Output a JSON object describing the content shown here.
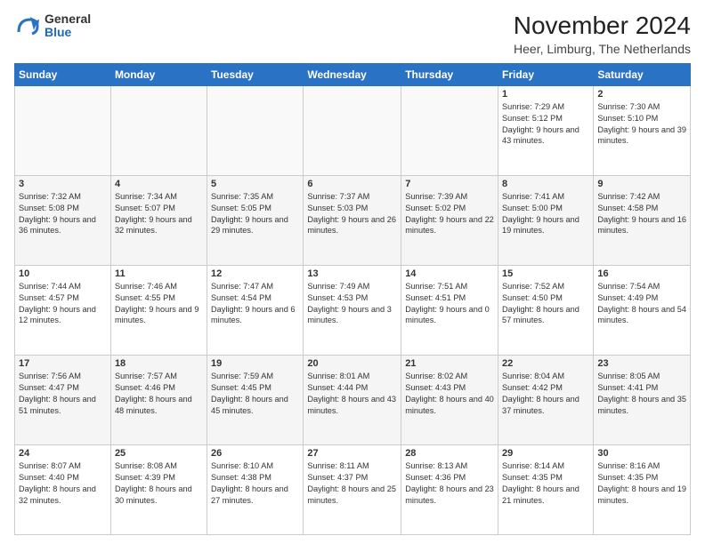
{
  "logo": {
    "text_general": "General",
    "text_blue": "Blue"
  },
  "header": {
    "title": "November 2024",
    "subtitle": "Heer, Limburg, The Netherlands"
  },
  "columns": [
    "Sunday",
    "Monday",
    "Tuesday",
    "Wednesday",
    "Thursday",
    "Friday",
    "Saturday"
  ],
  "weeks": [
    [
      {
        "day": "",
        "info": ""
      },
      {
        "day": "",
        "info": ""
      },
      {
        "day": "",
        "info": ""
      },
      {
        "day": "",
        "info": ""
      },
      {
        "day": "",
        "info": ""
      },
      {
        "day": "1",
        "info": "Sunrise: 7:29 AM\nSunset: 5:12 PM\nDaylight: 9 hours and 43 minutes."
      },
      {
        "day": "2",
        "info": "Sunrise: 7:30 AM\nSunset: 5:10 PM\nDaylight: 9 hours and 39 minutes."
      }
    ],
    [
      {
        "day": "3",
        "info": "Sunrise: 7:32 AM\nSunset: 5:08 PM\nDaylight: 9 hours and 36 minutes."
      },
      {
        "day": "4",
        "info": "Sunrise: 7:34 AM\nSunset: 5:07 PM\nDaylight: 9 hours and 32 minutes."
      },
      {
        "day": "5",
        "info": "Sunrise: 7:35 AM\nSunset: 5:05 PM\nDaylight: 9 hours and 29 minutes."
      },
      {
        "day": "6",
        "info": "Sunrise: 7:37 AM\nSunset: 5:03 PM\nDaylight: 9 hours and 26 minutes."
      },
      {
        "day": "7",
        "info": "Sunrise: 7:39 AM\nSunset: 5:02 PM\nDaylight: 9 hours and 22 minutes."
      },
      {
        "day": "8",
        "info": "Sunrise: 7:41 AM\nSunset: 5:00 PM\nDaylight: 9 hours and 19 minutes."
      },
      {
        "day": "9",
        "info": "Sunrise: 7:42 AM\nSunset: 4:58 PM\nDaylight: 9 hours and 16 minutes."
      }
    ],
    [
      {
        "day": "10",
        "info": "Sunrise: 7:44 AM\nSunset: 4:57 PM\nDaylight: 9 hours and 12 minutes."
      },
      {
        "day": "11",
        "info": "Sunrise: 7:46 AM\nSunset: 4:55 PM\nDaylight: 9 hours and 9 minutes."
      },
      {
        "day": "12",
        "info": "Sunrise: 7:47 AM\nSunset: 4:54 PM\nDaylight: 9 hours and 6 minutes."
      },
      {
        "day": "13",
        "info": "Sunrise: 7:49 AM\nSunset: 4:53 PM\nDaylight: 9 hours and 3 minutes."
      },
      {
        "day": "14",
        "info": "Sunrise: 7:51 AM\nSunset: 4:51 PM\nDaylight: 9 hours and 0 minutes."
      },
      {
        "day": "15",
        "info": "Sunrise: 7:52 AM\nSunset: 4:50 PM\nDaylight: 8 hours and 57 minutes."
      },
      {
        "day": "16",
        "info": "Sunrise: 7:54 AM\nSunset: 4:49 PM\nDaylight: 8 hours and 54 minutes."
      }
    ],
    [
      {
        "day": "17",
        "info": "Sunrise: 7:56 AM\nSunset: 4:47 PM\nDaylight: 8 hours and 51 minutes."
      },
      {
        "day": "18",
        "info": "Sunrise: 7:57 AM\nSunset: 4:46 PM\nDaylight: 8 hours and 48 minutes."
      },
      {
        "day": "19",
        "info": "Sunrise: 7:59 AM\nSunset: 4:45 PM\nDaylight: 8 hours and 45 minutes."
      },
      {
        "day": "20",
        "info": "Sunrise: 8:01 AM\nSunset: 4:44 PM\nDaylight: 8 hours and 43 minutes."
      },
      {
        "day": "21",
        "info": "Sunrise: 8:02 AM\nSunset: 4:43 PM\nDaylight: 8 hours and 40 minutes."
      },
      {
        "day": "22",
        "info": "Sunrise: 8:04 AM\nSunset: 4:42 PM\nDaylight: 8 hours and 37 minutes."
      },
      {
        "day": "23",
        "info": "Sunrise: 8:05 AM\nSunset: 4:41 PM\nDaylight: 8 hours and 35 minutes."
      }
    ],
    [
      {
        "day": "24",
        "info": "Sunrise: 8:07 AM\nSunset: 4:40 PM\nDaylight: 8 hours and 32 minutes."
      },
      {
        "day": "25",
        "info": "Sunrise: 8:08 AM\nSunset: 4:39 PM\nDaylight: 8 hours and 30 minutes."
      },
      {
        "day": "26",
        "info": "Sunrise: 8:10 AM\nSunset: 4:38 PM\nDaylight: 8 hours and 27 minutes."
      },
      {
        "day": "27",
        "info": "Sunrise: 8:11 AM\nSunset: 4:37 PM\nDaylight: 8 hours and 25 minutes."
      },
      {
        "day": "28",
        "info": "Sunrise: 8:13 AM\nSunset: 4:36 PM\nDaylight: 8 hours and 23 minutes."
      },
      {
        "day": "29",
        "info": "Sunrise: 8:14 AM\nSunset: 4:35 PM\nDaylight: 8 hours and 21 minutes."
      },
      {
        "day": "30",
        "info": "Sunrise: 8:16 AM\nSunset: 4:35 PM\nDaylight: 8 hours and 19 minutes."
      }
    ]
  ]
}
